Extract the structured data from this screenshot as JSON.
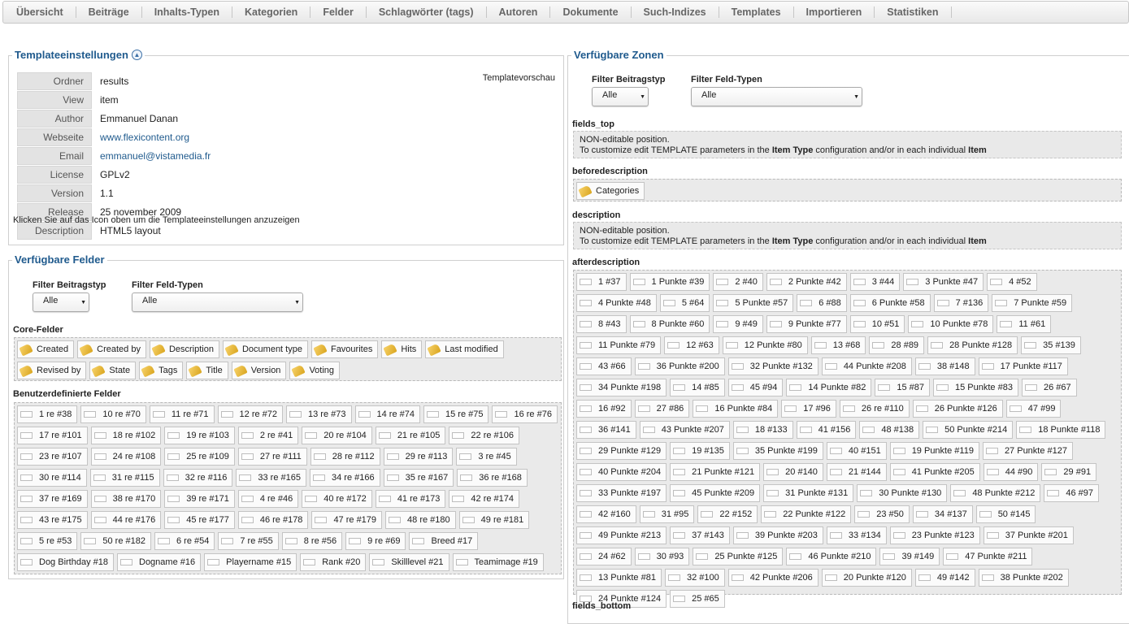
{
  "tabs": [
    "Übersicht",
    "Beiträge",
    "Inhalts-Typen",
    "Kategorien",
    "Felder",
    "Schlagwörter (tags)",
    "Autoren",
    "Dokumente",
    "Such-Indizes",
    "Templates",
    "Importieren",
    "Statistiken"
  ],
  "settings": {
    "legend": "Templateeinstellungen",
    "preview_label": "Templatevorschau",
    "rows": [
      {
        "label": "Ordner",
        "value": "results",
        "link": false
      },
      {
        "label": "View",
        "value": "item",
        "link": false
      },
      {
        "label": "Author",
        "value": "Emmanuel Danan",
        "link": false
      },
      {
        "label": "Webseite",
        "value": "www.flexicontent.org",
        "link": true
      },
      {
        "label": "Email",
        "value": "emmanuel@vistamedia.fr",
        "link": true
      },
      {
        "label": "License",
        "value": "GPLv2",
        "link": false
      },
      {
        "label": "Version",
        "value": "1.1",
        "link": false
      },
      {
        "label": "Release",
        "value": "25 november 2009",
        "link": false
      },
      {
        "label": "Description",
        "value": "HTML5 layout",
        "link": false
      }
    ],
    "hint": "Klicken Sie auf das Icon oben um die Templateeinstellungen anzuzeigen"
  },
  "fields": {
    "legend": "Verfügbare Felder",
    "filter_type_label": "Filter Beitragstyp",
    "filter_type_value": "Alle",
    "filter_field_label": "Filter Feld-Typen",
    "filter_field_value": "Alle",
    "core_label": "Core-Felder",
    "core": [
      "Created",
      "Created by",
      "Description",
      "Document type",
      "Favourites",
      "Hits",
      "Last modified",
      "Revised by",
      "State",
      "Tags",
      "Title",
      "Version",
      "Voting"
    ],
    "custom_label": "Benutzerdefinierte Felder",
    "custom": [
      "1 re #38",
      "10 re #70",
      "11 re #71",
      "12 re #72",
      "13 re #73",
      "14 re #74",
      "15 re #75",
      "16 re #76",
      "17 re #101",
      "18 re #102",
      "19 re #103",
      "2 re #41",
      "20 re #104",
      "21 re #105",
      "22 re #106",
      "23 re #107",
      "24 re #108",
      "25 re #109",
      "27 re #111",
      "28 re #112",
      "29 re #113",
      "3 re #45",
      "30 re #114",
      "31 re #115",
      "32 re #116",
      "33 re #165",
      "34 re #166",
      "35 re #167",
      "36 re #168",
      "37 re #169",
      "38 re #170",
      "39 re #171",
      "4 re #46",
      "40 re #172",
      "41 re #173",
      "42 re #174",
      "43 re #175",
      "44 re #176",
      "45 re #177",
      "46 re #178",
      "47 re #179",
      "48 re #180",
      "49 re #181",
      "5 re #53",
      "50 re #182",
      "6 re #54",
      "7 re #55",
      "8 re #56",
      "9 re #69",
      "Breed #17",
      "Dog Birthday #18",
      "Dogname #16",
      "Playername #15",
      "Rank #20",
      "Skilllevel #21",
      "Teamimage #19"
    ]
  },
  "zones": {
    "legend": "Verfügbare Zonen",
    "filter_type_label": "Filter Beitragstyp",
    "filter_type_value": "Alle",
    "filter_field_label": "Filter Feld-Typen",
    "filter_field_value": "Alle",
    "fields_top": "fields_top",
    "noneditable_line1": "NON-editable position.",
    "noneditable_line2_a": "To customize edit TEMPLATE parameters in the ",
    "noneditable_item_type": "Item Type",
    "noneditable_line2_b": " configuration and/or in each individual ",
    "noneditable_item": "Item",
    "beforedescription": "beforedescription",
    "beforedescription_items": [
      "Categories"
    ],
    "description": "description",
    "afterdescription": "afterdescription",
    "afterdescription_items": [
      "1 #37",
      "1 Punkte #39",
      "2 #40",
      "2 Punkte #42",
      "3 #44",
      "3 Punkte #47",
      "4 #52",
      "4 Punkte #48",
      "5 #64",
      "5 Punkte #57",
      "6 #88",
      "6 Punkte #58",
      "7 #136",
      "7 Punkte #59",
      "8 #43",
      "8 Punkte #60",
      "9 #49",
      "9 Punkte #77",
      "10 #51",
      "10 Punkte #78",
      "11 #61",
      "11 Punkte #79",
      "12 #63",
      "12 Punkte #80",
      "13 #68",
      "28 #89",
      "28 Punkte #128",
      "35 #139",
      "43 #66",
      "36 Punkte #200",
      "32 Punkte #132",
      "44 Punkte #208",
      "38 #148",
      "17 Punkte #117",
      "34 Punkte #198",
      "14 #85",
      "45 #94",
      "14 Punkte #82",
      "15 #87",
      "15 Punkte #83",
      "26 #67",
      "16 #92",
      "27 #86",
      "16 Punkte #84",
      "17 #96",
      "26 re #110",
      "26 Punkte #126",
      "47 #99",
      "36 #141",
      "43 Punkte #207",
      "18 #133",
      "41 #156",
      "48 #138",
      "50 Punkte #214",
      "18 Punkte #118",
      "29 Punkte #129",
      "19 #135",
      "35 Punkte #199",
      "40 #151",
      "19 Punkte #119",
      "27 Punkte #127",
      "40 Punkte #204",
      "21 Punkte #121",
      "20 #140",
      "21 #144",
      "41 Punkte #205",
      "44 #90",
      "29 #91",
      "33 Punkte #197",
      "45 Punkte #209",
      "31 Punkte #131",
      "30 Punkte #130",
      "48 Punkte #212",
      "46 #97",
      "42 #160",
      "31 #95",
      "22 #152",
      "22 Punkte #122",
      "23 #50",
      "34 #137",
      "50 #145",
      "49 Punkte #213",
      "37 #143",
      "39 Punkte #203",
      "33 #134",
      "23 Punkte #123",
      "37 Punkte #201",
      "24 #62",
      "30 #93",
      "25 Punkte #125",
      "46 Punkte #210",
      "39 #149",
      "47 Punkte #211",
      "13 Punkte #81",
      "32 #100",
      "42 Punkte #206",
      "20 Punkte #120",
      "49 #142",
      "38 Punkte #202",
      "24 Punkte #124",
      "25 #65"
    ],
    "fields_bottom": "fields_bottom"
  }
}
